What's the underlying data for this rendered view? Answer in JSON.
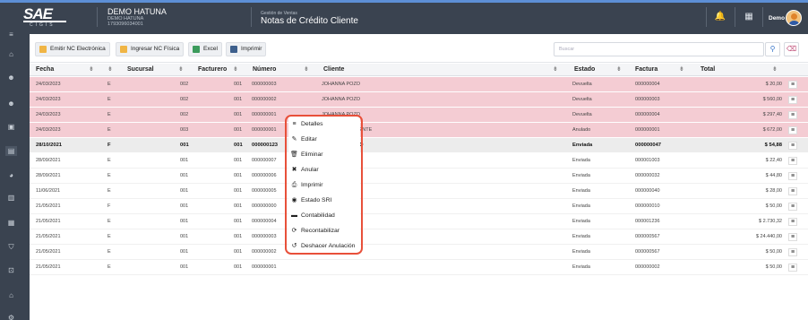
{
  "header": {
    "logo_main": "SAE",
    "logo_sub": "CIGIS",
    "company_name": "DEMO HATUNA",
    "company_sub": "DEMO HATUNA",
    "company_ruc": "1793096034001",
    "module_category": "Gestión de Ventas",
    "module_title": "Notas de Crédito Cliente",
    "user_name": "Demo"
  },
  "toolbar": {
    "emitir_label": "Emitir NC Electrónica",
    "ingresar_label": "Ingresar NC Física",
    "excel_label": "Excel",
    "imprimir_label": "Imprimir",
    "search_placeholder": "Buscar"
  },
  "table": {
    "columns": [
      "Fecha",
      "Sucursal",
      "Facturero",
      "Número",
      "Cliente",
      "Estado",
      "Factura",
      "Total"
    ],
    "rows": [
      {
        "style": "red",
        "fecha": "24/03/2023",
        "tipo": "E",
        "sucursal": "002",
        "facturero": "001",
        "numero": "000000003",
        "cliente": "JOHANNA POZO",
        "estado": "Devuelta",
        "factura": "000000004",
        "total": "$ 20,00"
      },
      {
        "style": "red",
        "fecha": "24/03/2023",
        "tipo": "E",
        "sucursal": "002",
        "facturero": "001",
        "numero": "000000002",
        "cliente": "JOHANNA POZO",
        "estado": "Devuelta",
        "factura": "000000003",
        "total": "$ 560,00"
      },
      {
        "style": "red",
        "fecha": "24/03/2023",
        "tipo": "E",
        "sucursal": "002",
        "facturero": "001",
        "numero": "000000001",
        "cliente": "JOHANNA POZO",
        "estado": "Devuelta",
        "factura": "000000004",
        "total": "$ 297,40"
      },
      {
        "style": "red",
        "fecha": "24/03/2023",
        "tipo": "E",
        "sucursal": "003",
        "facturero": "001",
        "numero": "000000001",
        "cliente": "PRUEBA DE CLIENTE",
        "estado": "Anulado",
        "factura": "000000001",
        "total": "$ 672,00"
      },
      {
        "style": "grey",
        "fecha": "28/10/2021",
        "tipo": "F",
        "sucursal": "001",
        "facturero": "001",
        "numero": "000000123",
        "cliente": "JOHANNA POZO",
        "estado": "Enviada",
        "factura": "000000047",
        "total": "$ 54,88"
      },
      {
        "style": "plain",
        "fecha": "28/09/2021",
        "tipo": "E",
        "sucursal": "001",
        "facturero": "001",
        "numero": "000000007",
        "cliente": "",
        "estado": "Enviada",
        "factura": "000001003",
        "total": "$ 22,40"
      },
      {
        "style": "plain",
        "fecha": "28/09/2021",
        "tipo": "E",
        "sucursal": "001",
        "facturero": "001",
        "numero": "000000006",
        "cliente": "",
        "estado": "Enviada",
        "factura": "000000032",
        "total": "$ 44,80"
      },
      {
        "style": "plain",
        "fecha": "11/06/2021",
        "tipo": "E",
        "sucursal": "001",
        "facturero": "001",
        "numero": "000000005",
        "cliente": "",
        "estado": "Enviada",
        "factura": "000000040",
        "total": "$ 28,00"
      },
      {
        "style": "plain",
        "fecha": "21/05/2021",
        "tipo": "F",
        "sucursal": "001",
        "facturero": "001",
        "numero": "000000000",
        "cliente": "",
        "estado": "Enviada",
        "factura": "000000010",
        "total": "$ 50,00"
      },
      {
        "style": "plain",
        "fecha": "21/05/2021",
        "tipo": "E",
        "sucursal": "001",
        "facturero": "001",
        "numero": "000000004",
        "cliente": "",
        "estado": "Enviada",
        "factura": "000001236",
        "total": "$ 2.730,32"
      },
      {
        "style": "plain",
        "fecha": "21/05/2021",
        "tipo": "E",
        "sucursal": "001",
        "facturero": "001",
        "numero": "000000003",
        "cliente": "",
        "estado": "Enviada",
        "factura": "000000567",
        "total": "$ 24.440,00"
      },
      {
        "style": "plain",
        "fecha": "21/05/2021",
        "tipo": "E",
        "sucursal": "001",
        "facturero": "001",
        "numero": "000000002",
        "cliente": "",
        "estado": "Enviada",
        "factura": "000000567",
        "total": "$ 50,00"
      },
      {
        "style": "plain",
        "fecha": "21/05/2021",
        "tipo": "E",
        "sucursal": "001",
        "facturero": "001",
        "numero": "000000001",
        "cliente": "",
        "estado": "Enviada",
        "factura": "000000002",
        "total": "$ 50,00"
      }
    ]
  },
  "context_menu": {
    "items": [
      {
        "label": "Detalles",
        "icon": "list-icon"
      },
      {
        "label": "Editar",
        "icon": "pencil-icon"
      },
      {
        "label": "Eliminar",
        "icon": "trash-icon"
      },
      {
        "label": "Anular",
        "icon": "x-icon"
      },
      {
        "label": "Imprimir",
        "icon": "printer-icon"
      },
      {
        "label": "Estado SRI",
        "icon": "globe-icon"
      },
      {
        "label": "Contabilidad",
        "icon": "book-icon"
      },
      {
        "label": "Recontabilizar",
        "icon": "refresh-icon"
      },
      {
        "label": "Deshacer Anulación",
        "icon": "undo-icon"
      }
    ]
  },
  "colors": {
    "accent": "#5d8fd6",
    "annulled_row": "#f4ccd3",
    "highlight_border": "#e8503a",
    "topbar": "#3a4350"
  }
}
